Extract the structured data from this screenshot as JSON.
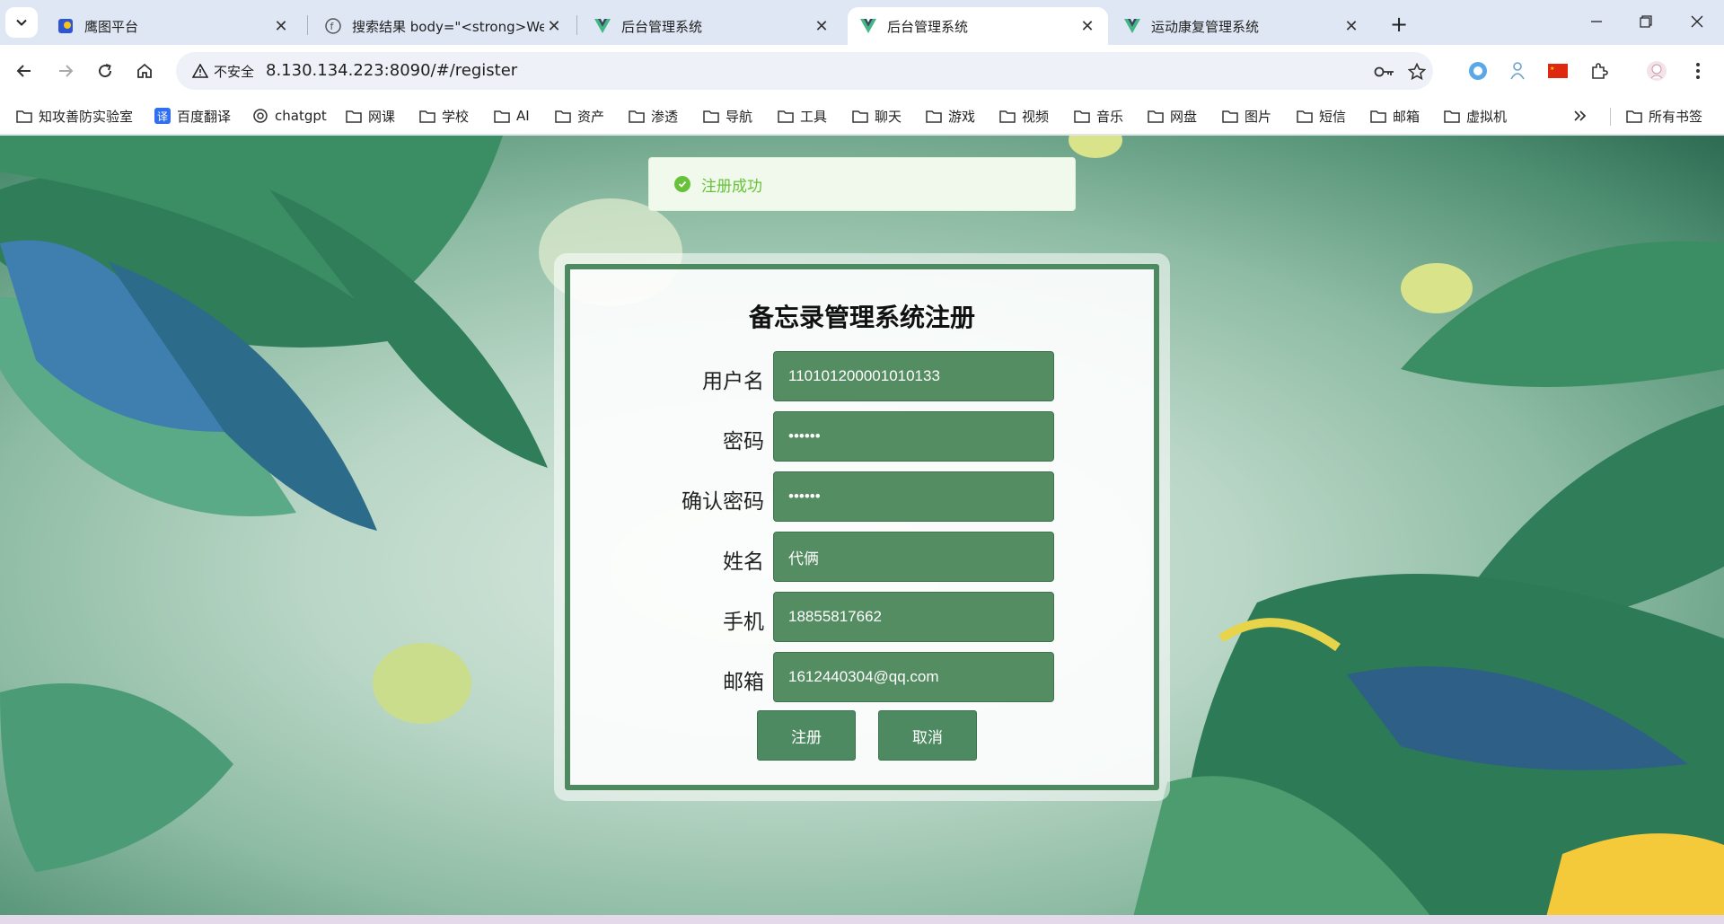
{
  "tabs": [
    {
      "title": "鹰图平台",
      "active": false
    },
    {
      "title": "搜索结果 body=\"<strong>We",
      "active": false
    },
    {
      "title": "后台管理系统",
      "active": false
    },
    {
      "title": "后台管理系统",
      "active": true
    },
    {
      "title": "运动康复管理系统",
      "active": false
    }
  ],
  "toolbar": {
    "insecure_label": "不安全",
    "url": "8.130.134.223:8090/#/register"
  },
  "bookmarks": [
    {
      "label": "知攻善防实验室",
      "icon": "folder-icon"
    },
    {
      "label": "百度翻译",
      "icon": "translate-icon"
    },
    {
      "label": "chatgpt",
      "icon": "openai-icon"
    },
    {
      "label": "网课",
      "icon": "folder-icon"
    },
    {
      "label": "学校",
      "icon": "folder-icon"
    },
    {
      "label": "AI",
      "icon": "folder-icon"
    },
    {
      "label": "资产",
      "icon": "folder-icon"
    },
    {
      "label": "渗透",
      "icon": "folder-icon"
    },
    {
      "label": "导航",
      "icon": "folder-icon"
    },
    {
      "label": "工具",
      "icon": "folder-icon"
    },
    {
      "label": "聊天",
      "icon": "folder-icon"
    },
    {
      "label": "游戏",
      "icon": "folder-icon"
    },
    {
      "label": "视频",
      "icon": "folder-icon"
    },
    {
      "label": "音乐",
      "icon": "folder-icon"
    },
    {
      "label": "网盘",
      "icon": "folder-icon"
    },
    {
      "label": "图片",
      "icon": "folder-icon"
    },
    {
      "label": "短信",
      "icon": "folder-icon"
    },
    {
      "label": "邮箱",
      "icon": "folder-icon"
    },
    {
      "label": "虚拟机",
      "icon": "folder-icon"
    }
  ],
  "all_bookmarks_label": "所有书签",
  "toast": {
    "message": "注册成功",
    "color": "#67c23a"
  },
  "form": {
    "title": "备忘录管理系统注册",
    "fields": [
      {
        "label": "用户名",
        "value": "110101200001010133"
      },
      {
        "label": "密码",
        "value": "••••••"
      },
      {
        "label": "确认密码",
        "value": "••••••"
      },
      {
        "label": "姓名",
        "value": "代俩"
      },
      {
        "label": "手机",
        "value": "18855817662"
      },
      {
        "label": "邮箱",
        "value": "1612440304@qq.com"
      }
    ],
    "register_label": "注册",
    "cancel_label": "取消"
  },
  "colors": {
    "accent": "#4d8a62",
    "input_bg": "#558d63"
  }
}
